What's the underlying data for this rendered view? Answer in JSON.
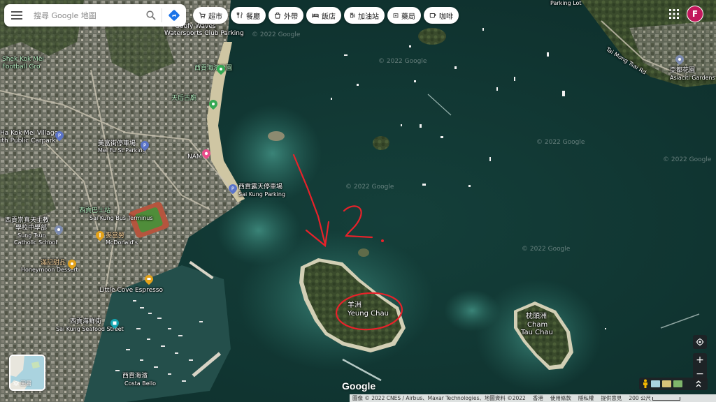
{
  "search": {
    "placeholder": "搜尋 Google 地圖"
  },
  "chips": [
    {
      "label": "超市",
      "icon": "cart-icon"
    },
    {
      "label": "餐廳",
      "icon": "restaurant-icon"
    },
    {
      "label": "外帶",
      "icon": "takeout-icon"
    },
    {
      "label": "飯店",
      "icon": "hotel-icon"
    },
    {
      "label": "加油站",
      "icon": "gas-station-icon"
    },
    {
      "label": "藥局",
      "icon": "pharmacy-icon"
    },
    {
      "label": "咖啡",
      "icon": "coffee-icon"
    }
  ],
  "account": {
    "initial": "F",
    "color": "#c2185b"
  },
  "map_labels": {
    "yeung_chau_zh": "羊洲",
    "yeung_chau_en": "Yeung Chau",
    "cham_tau_chau_zh": "枕頭洲",
    "cham_tau_chau_en1": "Cham",
    "cham_tau_chau_en2": "Tau Chau",
    "sai_kung_parking_zh": "西貢露天停車場",
    "sai_kung_parking_en": "Sai Kung Parking",
    "little_cove": "Little Cove Espresso",
    "watersports": "Watersports Club Parking",
    "goofy_waves": "Goofy Waves",
    "nam": "NAM",
    "mei_fu_st": "美富街停車場",
    "mei_fu_st_en": "Mei Fu St Parking",
    "kok_mei_village": "Ha Kok Mei Village",
    "kok_mei_carpark": "ith Public Carpark",
    "shek_mei_football": "Shek Kok Mei",
    "football_ground": "Football Gro",
    "mcdonalds": "麥當勞",
    "mcdonalds_en": "McDonald's",
    "honeymoon_zh": "滿記甜品",
    "honeymoon_en": "Honeymoon Dessert",
    "seafood_zh": "西貢海鮮街",
    "seafood_en": "Sai Kung Seafood Street",
    "costa_zh": "西貢海濱",
    "costa_en": "Costa Bello",
    "asiaciti_zh": "亞都花園",
    "asiaciti_en": "Asiaciti Gardens",
    "tai_mong_tsai": "Tai Mong Tsai Rd",
    "school_zh": "西貢崇真天主教",
    "school_zh2": "學校中學部",
    "school_en": "Sung Tsun",
    "school_en2": "Catholic School",
    "tin_hau": "天后古廟",
    "sai_kung_waterfront": "西貢海濱公園",
    "parking_top": "Parking Lot",
    "sai_kung_bus": "西貢巴士站",
    "sai_kung_bus_en": "Sai Kung Bus Terminus"
  },
  "watermarks": [
    "© 2022 Google",
    "© 2022 Google",
    "© 2022 Google",
    "© 2022 Google",
    "© 2022 Google",
    "© 2022 Google"
  ],
  "layers": {
    "label": "圖層"
  },
  "logo": "Google",
  "footer": {
    "imagery": "圖像 © 2022 CNES / Airbus、Maxar Technologies、地圖資料 ©2022",
    "region": "香港",
    "terms": "使用條款",
    "privacy": "隱私權",
    "feedback": "提供意見",
    "scale": "200 公尺"
  },
  "annotation": {
    "text": "2."
  }
}
